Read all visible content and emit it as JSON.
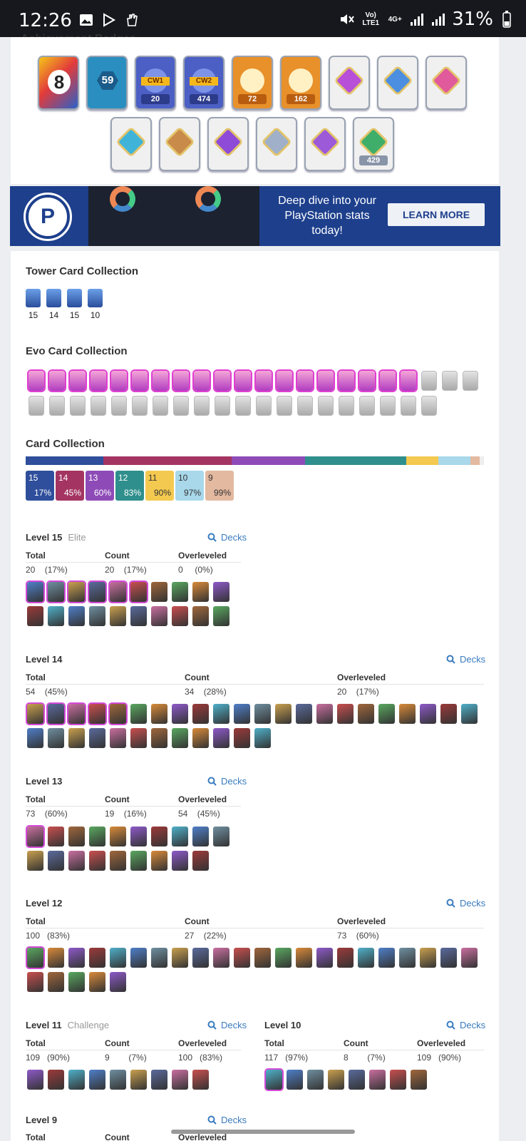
{
  "status_bar": {
    "time": "12:26",
    "network": "Vo) LTE1",
    "network2": "4G+",
    "battery": "31%",
    "icons": [
      "gallery-icon",
      "play-store-icon",
      "hand-icon",
      "mute-icon",
      "signal-icon",
      "battery-icon"
    ]
  },
  "badges": {
    "title": "Achievement Badges",
    "row1": [
      {
        "kind": "years",
        "value": "8",
        "bg": "#e23b3b"
      },
      {
        "kind": "level",
        "value": "59",
        "bg": "#2a8fc0"
      },
      {
        "kind": "cw1",
        "tag": "CW1",
        "value": "20",
        "bg": "#4b5fc4"
      },
      {
        "kind": "cw2",
        "tag": "CW2",
        "value": "474",
        "bg": "#4b5fc4"
      },
      {
        "kind": "cards",
        "value": "72",
        "bg": "#e8902a"
      },
      {
        "kind": "crown",
        "value": "162",
        "bg": "#e8902a"
      },
      {
        "kind": "medal-purple",
        "value": "",
        "bg": "#f0f0f0"
      },
      {
        "kind": "medal-blue",
        "value": "",
        "bg": "#f0f0f0"
      },
      {
        "kind": "medal-pink",
        "value": "",
        "bg": "#f0f0f0"
      }
    ],
    "row2": [
      {
        "kind": "medal-cards",
        "value": "",
        "bg": "#f0f0f0"
      },
      {
        "kind": "medal-king",
        "value": "",
        "bg": "#f0f0f0"
      },
      {
        "kind": "medal-crown-purple",
        "value": "",
        "bg": "#f0f0f0"
      },
      {
        "kind": "medal-silver",
        "value": "",
        "bg": "#f0f0f0"
      },
      {
        "kind": "medal-violet",
        "value": "",
        "bg": "#f0f0f0"
      },
      {
        "kind": "collection",
        "value": "429",
        "bg": "#f0f0f0"
      }
    ]
  },
  "ad": {
    "text": "Deep dive into your PlayStation stats today!",
    "button": "LEARN MORE",
    "logo": "P"
  },
  "tower": {
    "title": "Tower Card Collection",
    "items": [
      "15",
      "14",
      "15",
      "10"
    ]
  },
  "evo": {
    "title": "Evo Card Collection",
    "unlocked": 19,
    "total": 42
  },
  "collection": {
    "title": "Card Collection",
    "levels": [
      {
        "level": "15",
        "pct": "17%",
        "color": "#2f4f9c"
      },
      {
        "level": "14",
        "pct": "45%",
        "color": "#a43562"
      },
      {
        "level": "13",
        "pct": "60%",
        "color": "#8e4bb8"
      },
      {
        "level": "12",
        "pct": "83%",
        "color": "#2f8f8c"
      },
      {
        "level": "11",
        "pct": "90%",
        "color": "#f4c94f"
      },
      {
        "level": "10",
        "pct": "97%",
        "color": "#a8d8ea"
      },
      {
        "level": "9",
        "pct": "99%",
        "color": "#e3b9a0"
      }
    ],
    "bar_segments": [
      {
        "fraction": 0.17,
        "color": "#2f4f9c"
      },
      {
        "fraction": 0.28,
        "color": "#a43562"
      },
      {
        "fraction": 0.16,
        "color": "#8e4bb8"
      },
      {
        "fraction": 0.22,
        "color": "#2f8f8c"
      },
      {
        "fraction": 0.07,
        "color": "#f4c94f"
      },
      {
        "fraction": 0.07,
        "color": "#a8d8ea"
      },
      {
        "fraction": 0.02,
        "color": "#e3b9a0"
      },
      {
        "fraction": 0.01,
        "color": "#eeeeee"
      }
    ]
  },
  "labels": {
    "decks": "Decks",
    "total": "Total",
    "count": "Count",
    "overleveled": "Overleveled"
  },
  "level15": {
    "title": "Level 15",
    "sub": "Elite",
    "total": "20",
    "total_pct": "(17%)",
    "count": "20",
    "count_pct": "(17%)",
    "over": "0",
    "over_pct": "(0%)",
    "cards": 20
  },
  "level14": {
    "title": "Level 14",
    "total": "54",
    "total_pct": "(45%)",
    "count": "34",
    "count_pct": "(28%)",
    "over": "20",
    "over_pct": "(17%)",
    "cards": 34
  },
  "level13": {
    "title": "Level 13",
    "total": "73",
    "total_pct": "(60%)",
    "count": "19",
    "count_pct": "(16%)",
    "over": "54",
    "over_pct": "(45%)",
    "cards": 19
  },
  "level12": {
    "title": "Level 12",
    "total": "100",
    "total_pct": "(83%)",
    "count": "27",
    "count_pct": "(22%)",
    "over": "73",
    "over_pct": "(60%)",
    "cards": 27
  },
  "level11": {
    "title": "Level 11",
    "sub": "Challenge",
    "total": "109",
    "total_pct": "(90%)",
    "count": "9",
    "count_pct": "(7%)",
    "over": "100",
    "over_pct": "(83%)",
    "cards": 9
  },
  "level10": {
    "title": "Level 10",
    "total": "117",
    "total_pct": "(97%)",
    "count": "8",
    "count_pct": "(7%)",
    "over": "109",
    "over_pct": "(90%)",
    "cards": 8
  },
  "level9": {
    "title": "Level 9"
  }
}
